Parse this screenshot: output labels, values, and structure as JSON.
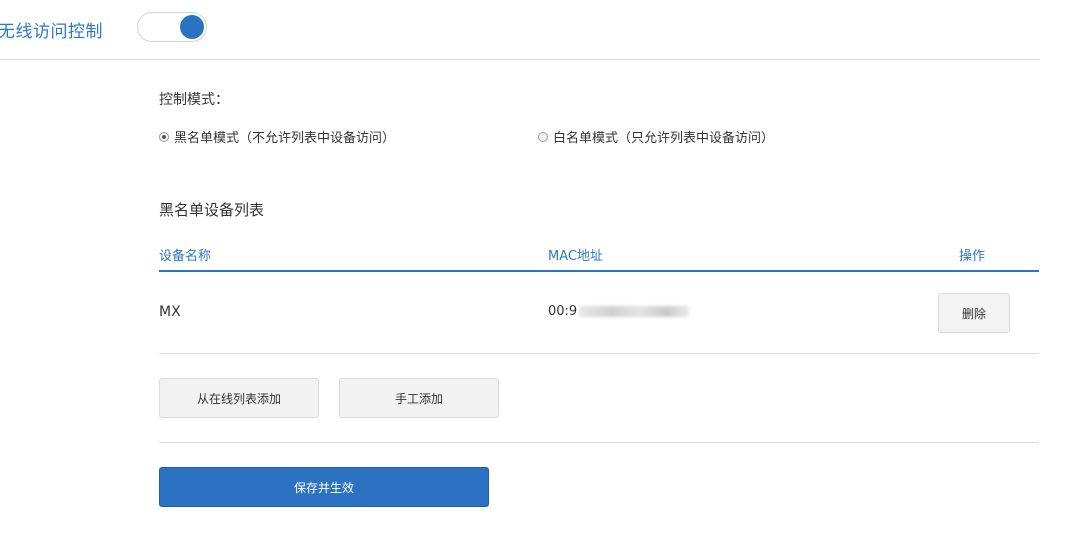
{
  "header": {
    "title": "无线访问控制",
    "toggle_state": "on"
  },
  "control_mode": {
    "label": "控制模式：",
    "options": [
      {
        "label": "黑名单模式（不允许列表中设备访问）",
        "selected": true
      },
      {
        "label": "白名单模式（只允许列表中设备访问）",
        "selected": false
      }
    ]
  },
  "blacklist": {
    "title": "黑名单设备列表",
    "columns": {
      "name": "设备名称",
      "mac": "MAC地址",
      "operation": "操作"
    },
    "rows": [
      {
        "name": "MX",
        "mac_visible": "00:9",
        "delete_label": "删除"
      }
    ]
  },
  "actions": {
    "add_from_online": "从在线列表添加",
    "add_manual": "手工添加",
    "save": "保存并生效"
  },
  "colors": {
    "accent": "#2c72c3",
    "header_text": "#2b78c5"
  }
}
